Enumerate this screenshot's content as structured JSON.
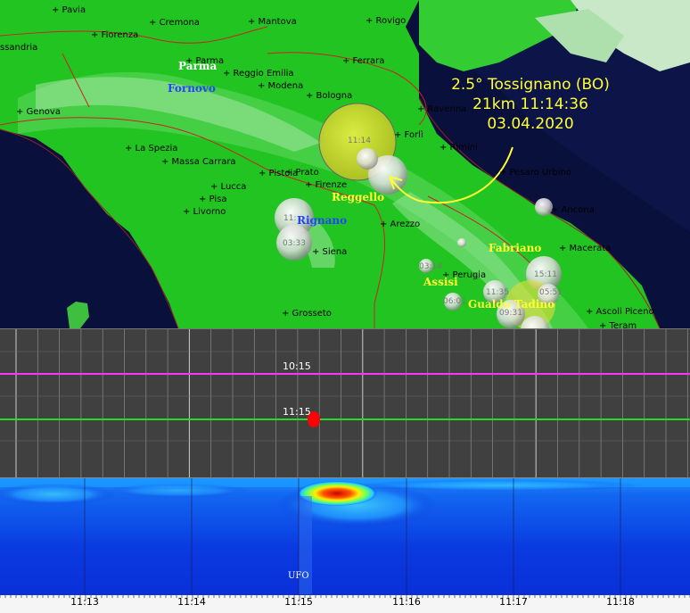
{
  "map": {
    "cities": [
      {
        "name": "Pavia"
      },
      {
        "name": "Cremona"
      },
      {
        "name": "Mantova"
      },
      {
        "name": "Rovigo"
      },
      {
        "name": "Fiorenza"
      },
      {
        "name": "Parma"
      },
      {
        "name": "Reggio Emilia"
      },
      {
        "name": "Ferrara"
      },
      {
        "name": "Modena"
      },
      {
        "name": "Bologna"
      },
      {
        "name": "Ravenna"
      },
      {
        "name": "Genova"
      },
      {
        "name": "Forlì"
      },
      {
        "name": "Rimini"
      },
      {
        "name": "La Spezia"
      },
      {
        "name": "Massa Carrara"
      },
      {
        "name": "Pistoia"
      },
      {
        "name": "Prato"
      },
      {
        "name": "Pesaro Urbino"
      },
      {
        "name": "Firenze"
      },
      {
        "name": "Lucca"
      },
      {
        "name": "Pisa"
      },
      {
        "name": "Livorno"
      },
      {
        "name": "Ancona"
      },
      {
        "name": "Arezzo"
      },
      {
        "name": "Siena"
      },
      {
        "name": "Macerata"
      },
      {
        "name": "Perugia"
      },
      {
        "name": "Grosseto"
      },
      {
        "name": "Ascoli Piceno"
      },
      {
        "name": "Teram"
      },
      {
        "name": "ssandria"
      }
    ],
    "places": [
      {
        "name": "Parma",
        "color": "#ffffff"
      },
      {
        "name": "Fornovo",
        "color": "#2244ff"
      },
      {
        "name": "Reggello",
        "color": "#ffff33"
      },
      {
        "name": "Rignano",
        "color": "#2244ff"
      },
      {
        "name": "Fabriano",
        "color": "#ffff33"
      },
      {
        "name": "Assisi",
        "color": "#ffff33"
      },
      {
        "name": "Gualdo Tadino",
        "color": "#ffff33"
      }
    ],
    "annotation": {
      "line1": "2.5° Tossignano (BO)",
      "line2": "21km 11:14:36",
      "line3": "03.04.2020",
      "color": "#ffff33"
    },
    "quake_labels": [
      "11:14",
      "11:",
      "03:33",
      "15:11",
      "11:35",
      "05:51",
      "09:31",
      "06:01",
      "03:14"
    ]
  },
  "seismograph": {
    "traces": [
      {
        "label": "10:15",
        "color": "#ff33ff"
      },
      {
        "label": "11:15",
        "color": "#22dd22"
      }
    ],
    "event_color": "#ff0000"
  },
  "spectrogram": {
    "label": "UFO",
    "bg_color": "#0a2fd8"
  },
  "time_axis": {
    "ticks": [
      "11:13",
      "11:14",
      "11:15",
      "11:16",
      "11:17",
      "11:18"
    ]
  }
}
